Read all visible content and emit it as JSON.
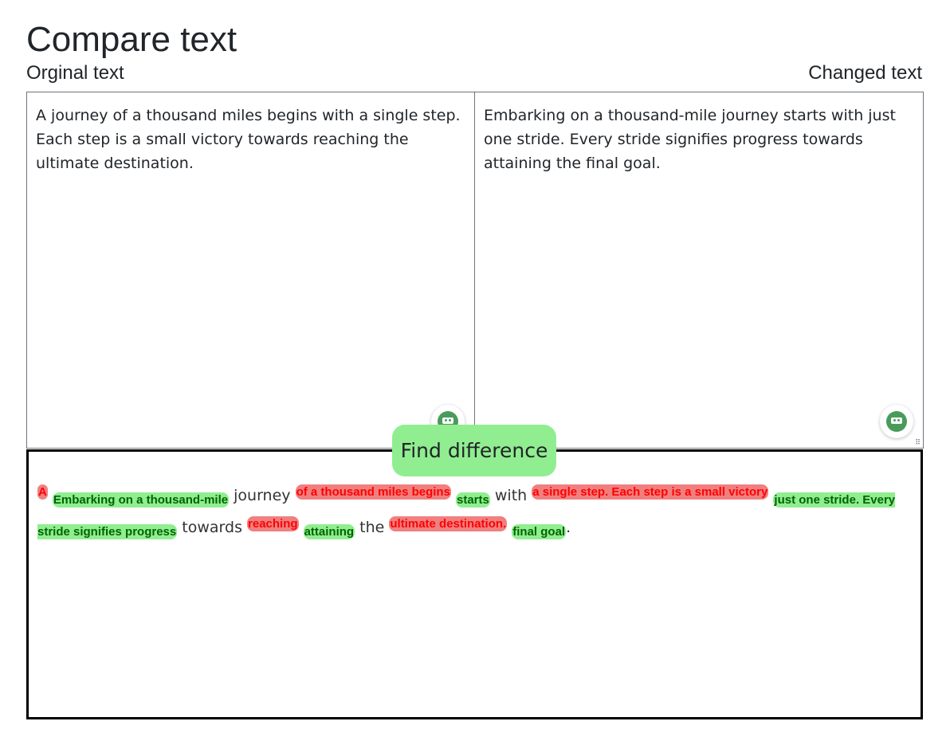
{
  "page": {
    "title": "Compare text",
    "original_label": "Orginal text",
    "changed_label": "Changed text"
  },
  "original": {
    "text": "A journey of a thousand miles begins with a single step. Each step is a small victory towards reaching the ultimate destination."
  },
  "changed": {
    "text": "Embarking on a thousand-mile journey starts with just one stride. Every stride signifies progress towards attaining the final goal."
  },
  "actions": {
    "find_difference_label": "Find difference"
  },
  "widgets": {
    "grammar_icon": "grammar-bot-icon",
    "resize_icon": "resize-grip-icon"
  },
  "colors": {
    "deleted_bg": "#f08080",
    "deleted_text": "#ff0000",
    "inserted_bg": "#90ee90",
    "inserted_text": "#006400",
    "button_bg": "#90ee90"
  },
  "diff": [
    {
      "type": "del",
      "text": "A"
    },
    {
      "type": "same",
      "text": " "
    },
    {
      "type": "ins",
      "text": "Embarking on a thousand-mile"
    },
    {
      "type": "same",
      "text": " journey "
    },
    {
      "type": "del",
      "text": "of a thousand miles begins"
    },
    {
      "type": "same",
      "text": " "
    },
    {
      "type": "ins",
      "text": "starts"
    },
    {
      "type": "same",
      "text": " with "
    },
    {
      "type": "del",
      "text": "a single step. Each step is a small victory"
    },
    {
      "type": "same",
      "text": " "
    },
    {
      "type": "ins",
      "text": "just one stride. Every stride signifies progress"
    },
    {
      "type": "same",
      "text": " towards "
    },
    {
      "type": "del",
      "text": "reaching"
    },
    {
      "type": "same",
      "text": " "
    },
    {
      "type": "ins",
      "text": "attaining"
    },
    {
      "type": "same",
      "text": " the "
    },
    {
      "type": "del",
      "text": "ultimate destination."
    },
    {
      "type": "same",
      "text": " "
    },
    {
      "type": "ins",
      "text": "final goal"
    },
    {
      "type": "same",
      "text": "."
    }
  ]
}
